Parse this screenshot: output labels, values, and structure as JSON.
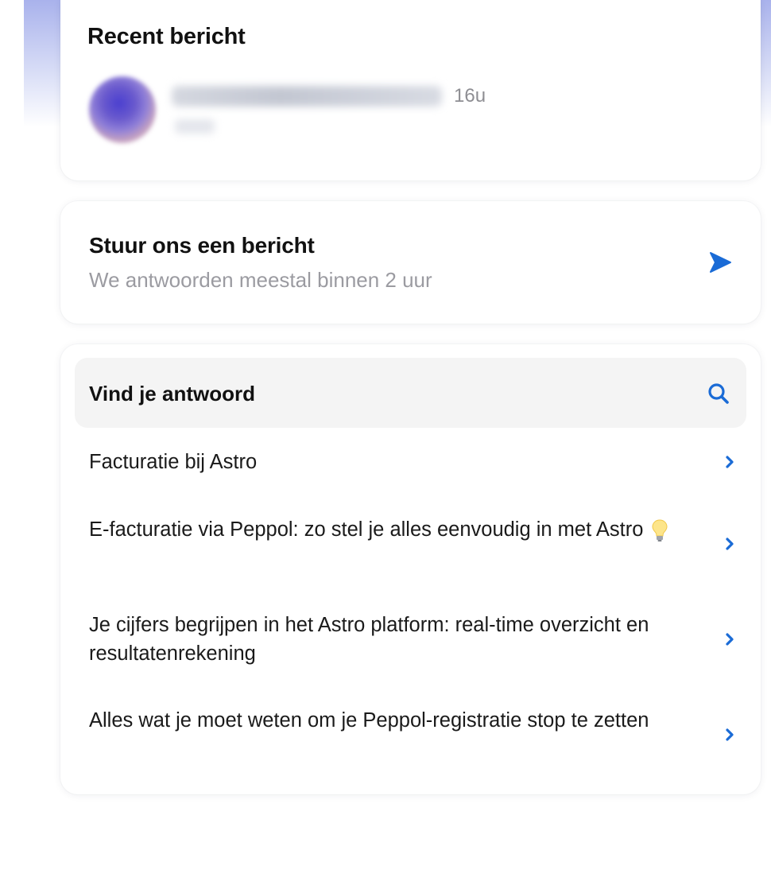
{
  "recent": {
    "title": "Recent bericht",
    "time": "16u"
  },
  "send": {
    "title": "Stuur ons een bericht",
    "subtitle": "We antwoorden meestal binnen 2 uur",
    "icon": "send-icon"
  },
  "help": {
    "search_label": "Vind je antwoord",
    "search_icon": "search-icon",
    "articles": [
      {
        "title": "Facturatie bij Astro"
      },
      {
        "title": "E-facturatie via Peppol: zo stel je alles eenvoudig in met Astro"
      },
      {
        "title": "Je cijfers begrijpen in het Astro platform: real-time overzicht en resultatenrekening"
      },
      {
        "title": "Alles wat je moet weten om je Peppol-registratie stop te zetten"
      }
    ]
  },
  "colors": {
    "accent": "#1a6bd6",
    "muted_text": "#9b9ba1",
    "header_gradient_top": "#a9b2ec"
  }
}
